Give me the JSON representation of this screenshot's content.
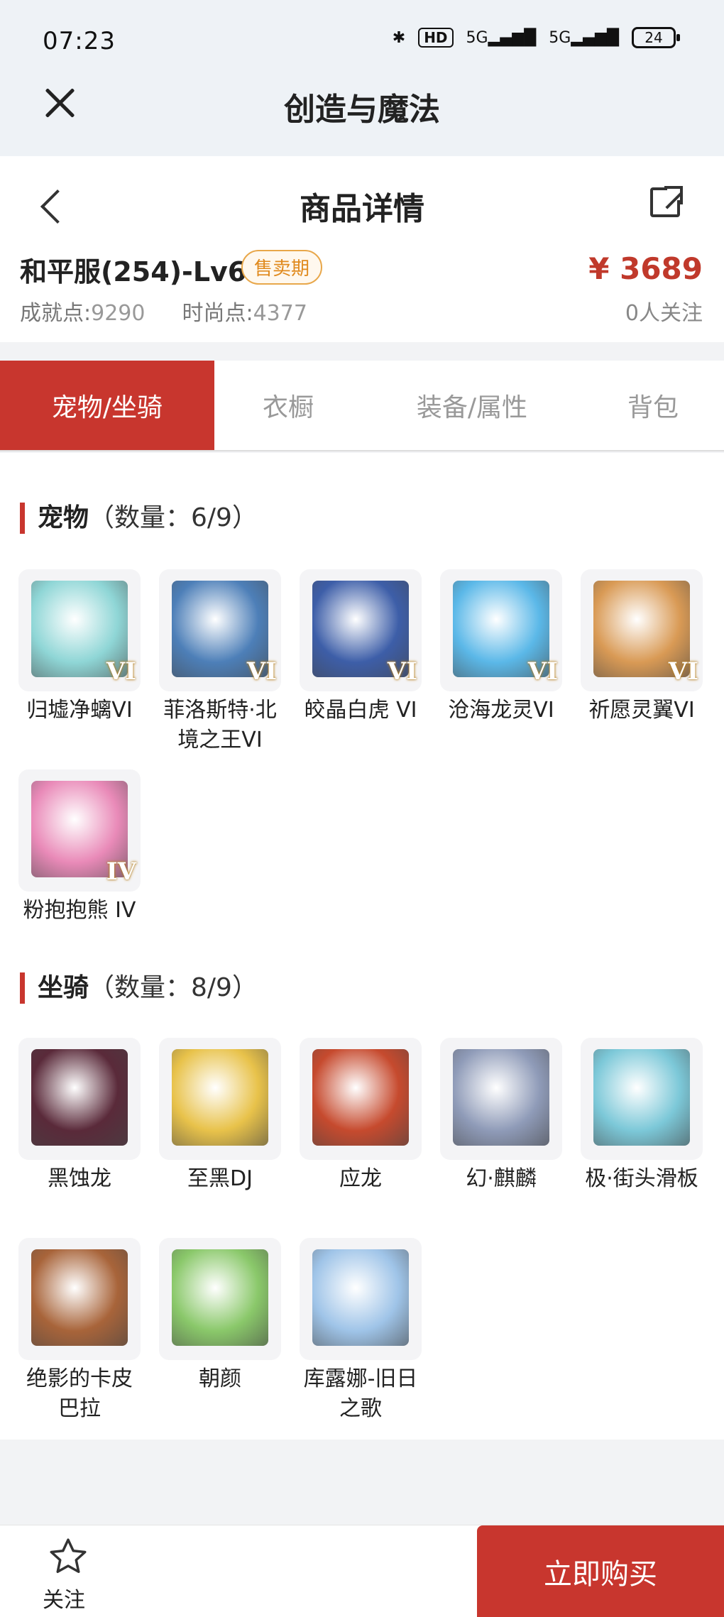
{
  "status_bar": {
    "time": "07:23",
    "hd": "HD",
    "net1": "5G",
    "net2": "5G",
    "battery": "24"
  },
  "app_header": {
    "title": "创造与魔法"
  },
  "page_header": {
    "title": "商品详情"
  },
  "item": {
    "name": "和平服(254)-Lv69",
    "badge": "售卖期",
    "price": "¥ 3689",
    "achievement_label": "成就点:",
    "achievement_value": "9290",
    "fashion_label": "时尚点:",
    "fashion_value": "4377",
    "followers": "0人关注"
  },
  "tabs": [
    {
      "label": "宠物/坐骑",
      "active": true
    },
    {
      "label": "衣橱",
      "active": false
    },
    {
      "label": "装备/属性",
      "active": false
    },
    {
      "label": "背包",
      "active": false
    }
  ],
  "pets": {
    "title": "宠物",
    "count": "（数量：6/9）",
    "items": [
      {
        "name": "归墟净螭VI",
        "level": "VI",
        "color": "#8fd6d6"
      },
      {
        "name": "菲洛斯特·北境之王VI",
        "level": "VI",
        "color": "#4d7fb8"
      },
      {
        "name": "皎晶白虎 VI",
        "level": "VI",
        "color": "#3d5ea8"
      },
      {
        "name": "沧海龙灵VI",
        "level": "VI",
        "color": "#5bb8e8"
      },
      {
        "name": "祈愿灵翼VI",
        "level": "VI",
        "color": "#d99a55"
      },
      {
        "name": "粉抱抱熊 IV",
        "level": "IV",
        "color": "#e98ab8"
      }
    ]
  },
  "mounts": {
    "title": "坐骑",
    "count": "（数量：8/9）",
    "items": [
      {
        "name": "黑蚀龙",
        "color": "#5a2a3a"
      },
      {
        "name": "至黑DJ",
        "color": "#e8c24a"
      },
      {
        "name": "应龙",
        "color": "#c64a2e"
      },
      {
        "name": "幻·麒麟",
        "color": "#8f9bb8"
      },
      {
        "name": "极·街头滑板",
        "color": "#7cc8d8"
      },
      {
        "name": "绝影的卡皮巴拉",
        "color": "#a8643a"
      },
      {
        "name": "朝颜",
        "color": "#8ac86a"
      },
      {
        "name": "库露娜-旧日之歌",
        "color": "#9fc4e8"
      }
    ]
  },
  "footer": {
    "follow_label": "关注",
    "buy_label": "立即购买"
  }
}
